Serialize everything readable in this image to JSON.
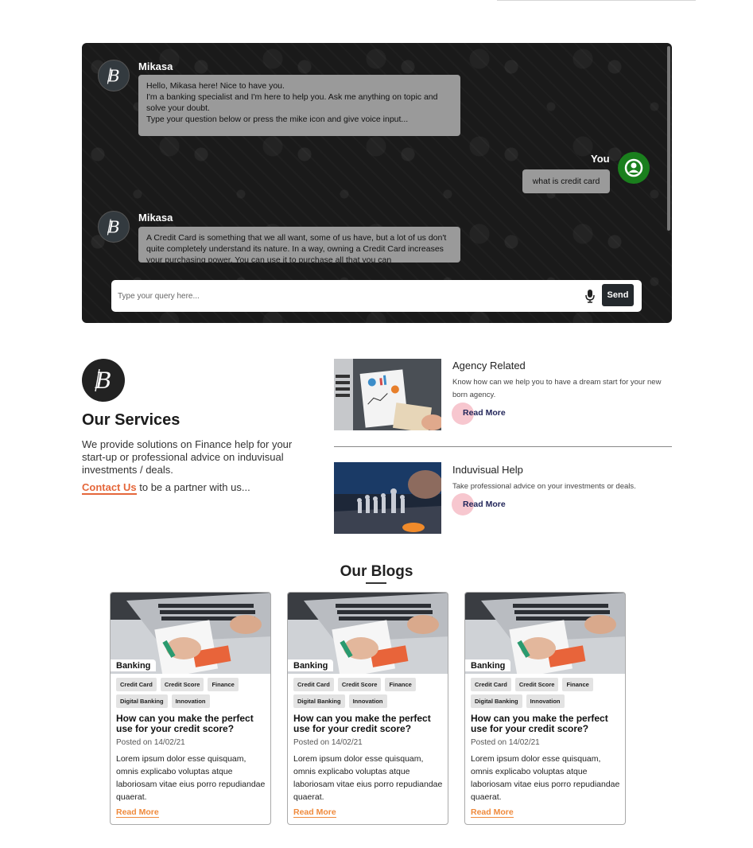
{
  "chat": {
    "messages": [
      {
        "sender": "Mikasa",
        "text": "Hello, Mikasa here! Nice to have you.\nI'm a banking specialist and I'm here to help you. Ask me anything on topic and solve your doubt.\nType your question below or press the mike icon and give voice input..."
      },
      {
        "sender": "You",
        "text": "what is credit card"
      },
      {
        "sender": "Mikasa",
        "text": "A Credit Card is something that we all want, some of us have, but a lot of us don't quite completely understand its nature. In a way, owning a Credit Card increases your purchasing power. You can use it to purchase all that you can"
      }
    ],
    "input_placeholder": "Type your query here...",
    "send_label": "Send"
  },
  "services": {
    "title": "Our Services",
    "description": "We provide solutions on Finance help for your start-up or professional advice on induvisual investments / deals.",
    "contact_link": "Contact Us",
    "contact_suffix": " to be a partner with us...",
    "cards": [
      {
        "title": "Agency Related",
        "text": "Know how can we help you to have a dream start for your new born agency.",
        "read_more": "Read More"
      },
      {
        "title": "Induvisual Help",
        "text": "Take professional advice on your investments or deals.",
        "read_more": "Read More"
      }
    ]
  },
  "blogs": {
    "title": "Our Blogs",
    "cards": [
      {
        "category": "Banking",
        "tags": [
          "Credit Card",
          "Credit Score",
          "Finance",
          "Digital Banking",
          "Innovation"
        ],
        "title": "How can you make the perfect use for your credit score?",
        "date": "Posted on 14/02/21",
        "body": "Lorem ipsum dolor esse quisquam, omnis explicabo voluptas atque laboriosam vitae eius porro repudiandae quaerat.",
        "read_more": "Read More"
      },
      {
        "category": "Banking",
        "tags": [
          "Credit Card",
          "Credit Score",
          "Finance",
          "Digital Banking",
          "Innovation"
        ],
        "title": "How can you make the perfect use for your credit score?",
        "date": "Posted on 14/02/21",
        "body": "Lorem ipsum dolor esse quisquam, omnis explicabo voluptas atque laboriosam vitae eius porro repudiandae quaerat.",
        "read_more": "Read More"
      },
      {
        "category": "Banking",
        "tags": [
          "Credit Card",
          "Credit Score",
          "Finance",
          "Digital Banking",
          "Innovation"
        ],
        "title": "How can you make the perfect use for your credit score?",
        "date": "Posted on 14/02/21",
        "body": "Lorem ipsum dolor esse quisquam, omnis explicabo voluptas atque laboriosam vitae eius porro repudiandae quaerat.",
        "read_more": "Read More"
      }
    ]
  },
  "icons": {
    "bot_avatar": "b-logo-icon",
    "user_avatar": "user-circle-icon",
    "mic": "microphone-icon"
  },
  "colors": {
    "accent": "#e5673b",
    "user_avatar": "#1a7f1d",
    "read_more_blog": "#ef8a3c",
    "read_more_service": "#22265a"
  }
}
